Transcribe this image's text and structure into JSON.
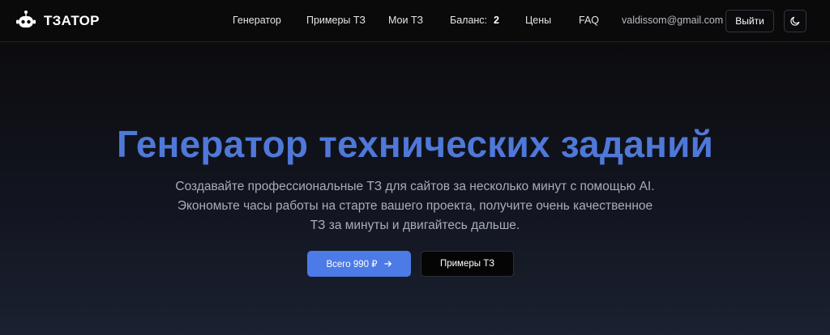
{
  "header": {
    "brand": "ТЗАТОР",
    "nav": [
      {
        "label": "Генератор"
      },
      {
        "label": "Примеры ТЗ"
      },
      {
        "label": "Мои ТЗ"
      }
    ],
    "balance_label": "Баланс:",
    "balance_value": "2",
    "nav_after": [
      {
        "label": "Цены"
      },
      {
        "label": "FAQ"
      }
    ],
    "user_email": "valdissom@gmail.com",
    "logout_label": "Выйти",
    "theme_icon": "moon-icon"
  },
  "hero": {
    "title": "Генератор технических заданий",
    "subtitle": "Создавайте профессиональные ТЗ для сайтов за несколько минут с помощью AI. Экономьте часы работы на старте вашего проекта, получите очень качественное ТЗ за минуты и двигайтесь дальше.",
    "primary_button": "Всего 990 ₽",
    "secondary_button": "Примеры ТЗ"
  },
  "colors": {
    "accent": "#4c7ae6",
    "title": "#4f78d8",
    "background": "#0b0b0d"
  }
}
